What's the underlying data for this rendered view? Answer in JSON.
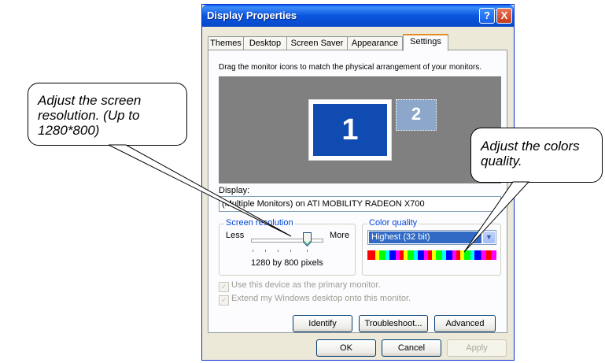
{
  "window": {
    "title": "Display Properties",
    "help_glyph": "?",
    "close_glyph": "X"
  },
  "tabs": [
    {
      "label": "Themes",
      "active": false
    },
    {
      "label": "Desktop",
      "active": false
    },
    {
      "label": "Screen Saver",
      "active": false
    },
    {
      "label": "Appearance",
      "active": false
    },
    {
      "label": "Settings",
      "active": true
    }
  ],
  "settings": {
    "instruction": "Drag the monitor icons to match the physical arrangement of your monitors.",
    "monitor_primary": "1",
    "monitor_secondary": "2",
    "display_label": "Display:",
    "display_value": "(Multiple Monitors) on ATI MOBILITY RADEON X700",
    "resolution_group": "Screen resolution",
    "less_label": "Less",
    "more_label": "More",
    "resolution_value": "1280 by 800 pixels",
    "color_group": "Color quality",
    "color_value": "Highest (32 bit)",
    "primary_monitor_label": "Use this device as the primary monitor.",
    "extend_desktop_label": "Extend my Windows desktop onto this monitor.",
    "identify_label": "Identify",
    "troubleshoot_label": "Troubleshoot...",
    "advanced_label": "Advanced"
  },
  "footer": {
    "ok_label": "OK",
    "cancel_label": "Cancel",
    "apply_label": "Apply"
  },
  "callouts": {
    "resolution": "Adjust the screen resolution. (Up to 1280*800)",
    "colors": "Adjust the colors quality."
  },
  "colors": {
    "title_blue": "#0A55E0",
    "selection_blue": "#316AC5",
    "monitor_blue": "#0F4BB0",
    "group_title": "#0046D5"
  }
}
